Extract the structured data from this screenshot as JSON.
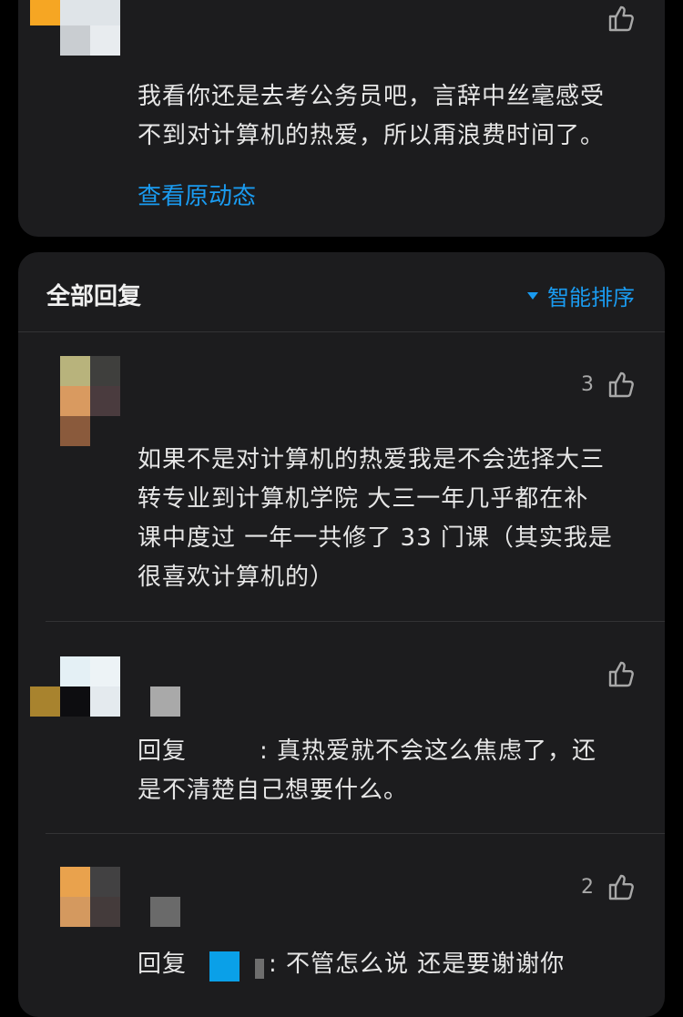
{
  "top_comment": {
    "text_line1": "我看你还是去考公务员吧，言辞中丝毫感受",
    "text_line2": "不到对计算机的热爱，所以甭浪费时间了。",
    "view_original": "查看原动态",
    "like_count": ""
  },
  "replies_header": {
    "title": "全部回复",
    "sort_label": "智能排序"
  },
  "replies": [
    {
      "like_count": "3",
      "lines": [
        "如果不是对计算机的热爱我是不会选择大三",
        "转专业到计算机学院 大三一年几乎都在补",
        "课中度过 一年一共修了 33 门课（其实我是",
        "很喜欢计算机的）"
      ]
    },
    {
      "like_count": "",
      "reply_prefix": "回复",
      "lines": [
        ": 真热爱就不会这么焦虑了，还",
        "是不清楚自己想要什么。"
      ]
    },
    {
      "like_count": "2",
      "reply_prefix": "回复",
      "lines": [
        ": 不管怎么说 还是要谢谢你"
      ]
    }
  ],
  "colors": {
    "background": "#000000",
    "card": "#1c1c1e",
    "accent": "#1a9bf0"
  },
  "icons": {
    "like": "thumbs-up-icon",
    "sort": "caret-down-icon"
  }
}
